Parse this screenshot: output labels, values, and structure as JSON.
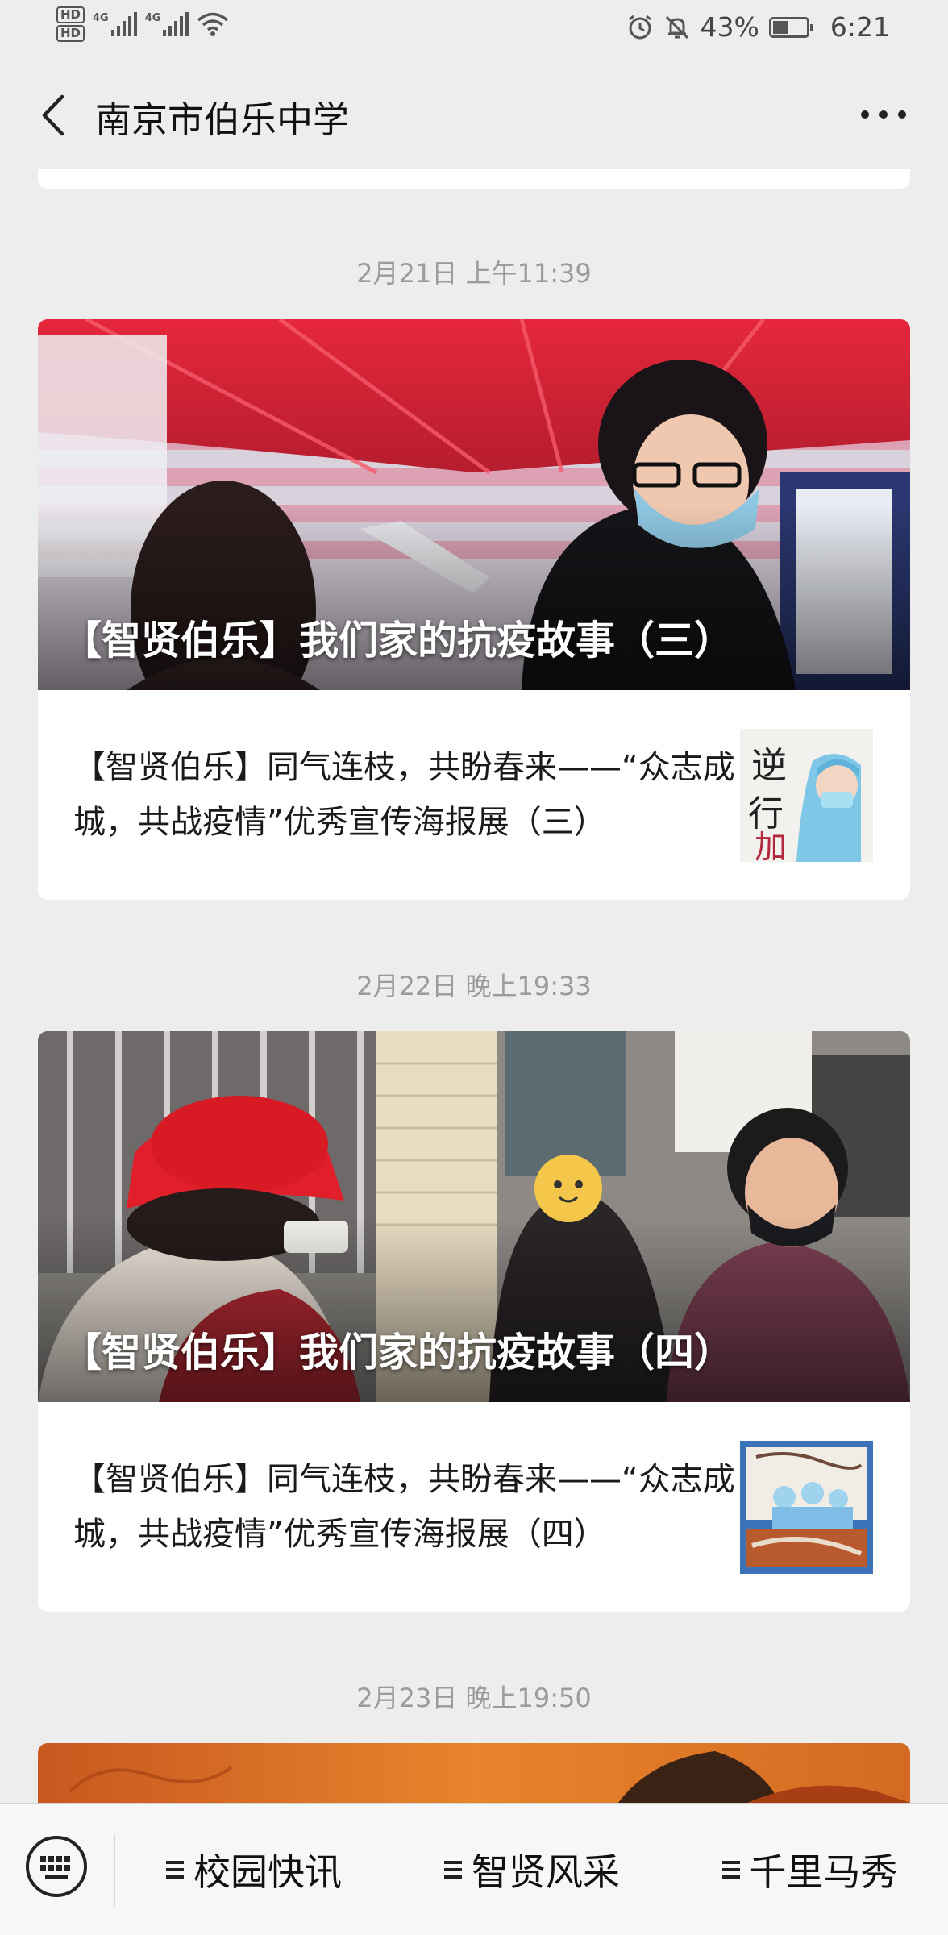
{
  "status_bar": {
    "hd1": "HD",
    "hd2": "HD",
    "net1": "4G",
    "net2": "4G",
    "battery": "43%",
    "time": "6:21",
    "icons": [
      "alarm-icon",
      "mute-icon",
      "battery-icon",
      "wifi-icon",
      "signal-icon"
    ]
  },
  "header": {
    "title": "南京市伯乐中学",
    "back_icon": "chevron-left-icon",
    "more_icon": "more-dots-icon"
  },
  "feed": [
    {
      "timestamp": "2月21日 上午11:39",
      "main_title": "【智贤伯乐】我们家的抗疫故事（三）",
      "sub_title": "【智贤伯乐】同气连枝，共盼春来——“众志成城，共战疫情”优秀宣传海报展（三）"
    },
    {
      "timestamp": "2月22日 晚上19:33",
      "main_title": "【智贤伯乐】我们家的抗疫故事（四）",
      "sub_title": "【智贤伯乐】同气连枝，共盼春来——“众志成城，共战疫情”优秀宣传海报展（四）"
    },
    {
      "timestamp": "2月23日 晚上19:50"
    }
  ],
  "bottom_menu": {
    "keyboard_icon": "keyboard-icon",
    "items": [
      "校园快讯",
      "智贤风采",
      "千里马秀"
    ]
  },
  "colors": {
    "background": "#ededed",
    "card": "#ffffff",
    "timestamp": "#9b9b9b",
    "tent_red": "#d8283a"
  }
}
